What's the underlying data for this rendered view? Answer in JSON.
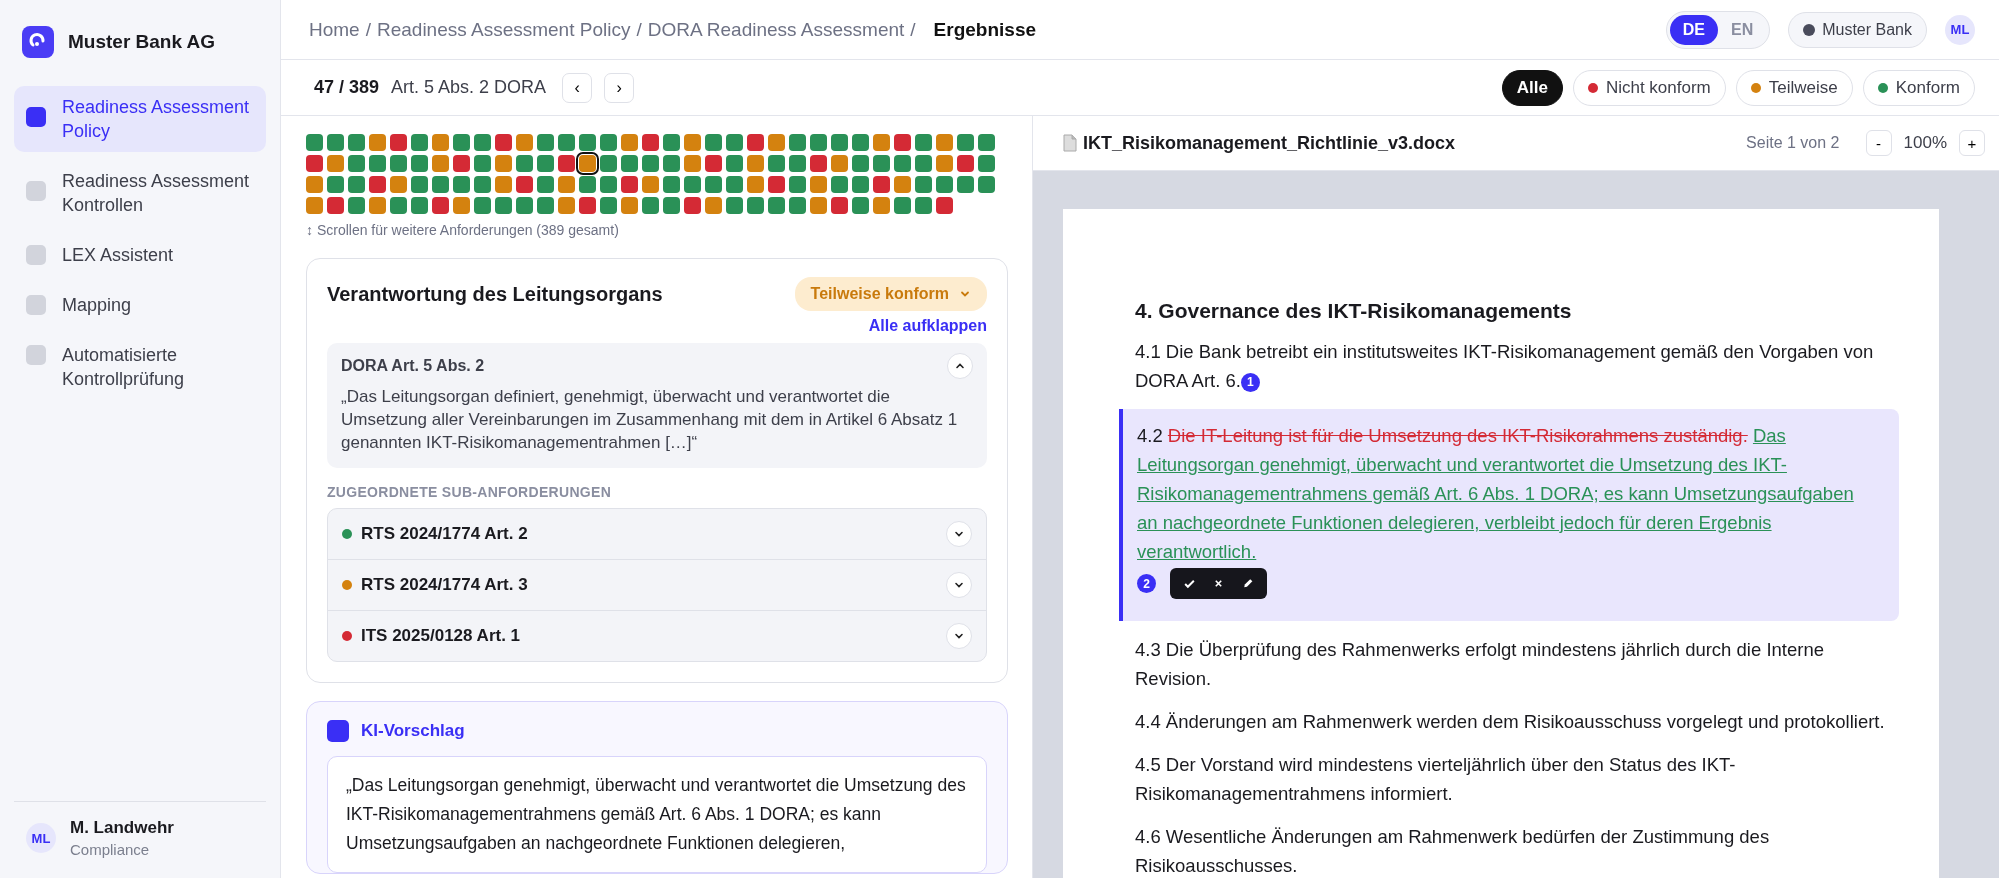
{
  "sidebar": {
    "brand": "Muster Bank AG",
    "items": [
      {
        "label": "Readiness Assessment Policy",
        "selected": true
      },
      {
        "label": "Readiness Assessment Kontrollen",
        "selected": false
      },
      {
        "label": "LEX Assistent",
        "selected": false
      },
      {
        "label": "Mapping",
        "selected": false
      },
      {
        "label": "Automatisierte Kontrollprüfung",
        "selected": false
      }
    ],
    "user": {
      "initials": "ML",
      "name": "M. Landwehr",
      "role": "Compliance"
    }
  },
  "header": {
    "breadcrumb": [
      "Home",
      "Readiness Assessment Policy",
      "DORA Readiness Assessment"
    ],
    "separator": "/",
    "current": "Ergebnisse",
    "languages": [
      {
        "label": "DE",
        "selected": true
      },
      {
        "label": "EN",
        "selected": false
      }
    ],
    "tenant": "Muster Bank",
    "avatar": "ML"
  },
  "toolbar": {
    "position": "47 / 389",
    "requirement": "Art. 5 Abs. 2 DORA",
    "prev": "‹",
    "next": "›",
    "filters": [
      {
        "label": "Alle",
        "selected": true
      },
      {
        "label": "Nicht konform",
        "selected": false,
        "color": "#d42a35"
      },
      {
        "label": "Teilweise",
        "selected": false,
        "color": "#d4820f"
      },
      {
        "label": "Konform",
        "selected": false,
        "color": "#2a9157"
      }
    ]
  },
  "grid": {
    "rows": [
      {
        "cells": [
          {
            "color": "#2a9157",
            "selected": false
          },
          {
            "color": "#2a9157",
            "selected": false
          },
          {
            "color": "#2a9157",
            "selected": false
          },
          {
            "color": "#d4820f",
            "selected": false
          },
          {
            "color": "#d42a35",
            "selected": false
          },
          {
            "color": "#2a9157",
            "selected": false
          },
          {
            "color": "#d4820f",
            "selected": false
          },
          {
            "color": "#2a9157",
            "selected": false
          },
          {
            "color": "#2a9157",
            "selected": false
          },
          {
            "color": "#d42a35",
            "selected": false
          },
          {
            "color": "#d4820f",
            "selected": false
          },
          {
            "color": "#2a9157",
            "selected": false
          },
          {
            "color": "#2a9157",
            "selected": false
          },
          {
            "color": "#2a9157",
            "selected": false
          },
          {
            "color": "#2a9157",
            "selected": false
          },
          {
            "color": "#d4820f",
            "selected": false
          },
          {
            "color": "#d42a35",
            "selected": false
          },
          {
            "color": "#2a9157",
            "selected": false
          },
          {
            "color": "#d4820f",
            "selected": false
          },
          {
            "color": "#2a9157",
            "selected": false
          },
          {
            "color": "#2a9157",
            "selected": false
          },
          {
            "color": "#d42a35",
            "selected": false
          },
          {
            "color": "#d4820f",
            "selected": false
          },
          {
            "color": "#2a9157",
            "selected": false
          },
          {
            "color": "#2a9157",
            "selected": false
          },
          {
            "color": "#2a9157",
            "selected": false
          },
          {
            "color": "#2a9157",
            "selected": false
          },
          {
            "color": "#d4820f",
            "selected": false
          },
          {
            "color": "#d42a35",
            "selected": false
          },
          {
            "color": "#2a9157",
            "selected": false
          },
          {
            "color": "#d4820f",
            "selected": false
          },
          {
            "color": "#2a9157",
            "selected": false
          },
          {
            "color": "#2a9157",
            "selected": false
          }
        ]
      },
      {
        "cells": [
          {
            "color": "#d42a35",
            "selected": false
          },
          {
            "color": "#d4820f",
            "selected": false
          },
          {
            "color": "#2a9157",
            "selected": false
          },
          {
            "color": "#2a9157",
            "selected": false
          },
          {
            "color": "#2a9157",
            "selected": false
          },
          {
            "color": "#2a9157",
            "selected": false
          },
          {
            "color": "#d4820f",
            "selected": false
          },
          {
            "color": "#d42a35",
            "selected": false
          },
          {
            "color": "#2a9157",
            "selected": false
          },
          {
            "color": "#d4820f",
            "selected": false
          },
          {
            "color": "#2a9157",
            "selected": false
          },
          {
            "color": "#2a9157",
            "selected": false
          },
          {
            "color": "#d42a35",
            "selected": false
          },
          {
            "color": "#d4820f",
            "selected": true
          },
          {
            "color": "#2a9157",
            "selected": false
          },
          {
            "color": "#2a9157",
            "selected": false
          },
          {
            "color": "#2a9157",
            "selected": false
          },
          {
            "color": "#2a9157",
            "selected": false
          },
          {
            "color": "#d4820f",
            "selected": false
          },
          {
            "color": "#d42a35",
            "selected": false
          },
          {
            "color": "#2a9157",
            "selected": false
          },
          {
            "color": "#d4820f",
            "selected": false
          },
          {
            "color": "#2a9157",
            "selected": false
          },
          {
            "color": "#2a9157",
            "selected": false
          },
          {
            "color": "#d42a35",
            "selected": false
          },
          {
            "color": "#d4820f",
            "selected": false
          },
          {
            "color": "#2a9157",
            "selected": false
          },
          {
            "color": "#2a9157",
            "selected": false
          },
          {
            "color": "#2a9157",
            "selected": false
          },
          {
            "color": "#2a9157",
            "selected": false
          },
          {
            "color": "#d4820f",
            "selected": false
          },
          {
            "color": "#d42a35",
            "selected": false
          },
          {
            "color": "#2a9157",
            "selected": false
          }
        ]
      },
      {
        "cells": [
          {
            "color": "#d4820f",
            "selected": false
          },
          {
            "color": "#2a9157",
            "selected": false
          },
          {
            "color": "#2a9157",
            "selected": false
          },
          {
            "color": "#d42a35",
            "selected": false
          },
          {
            "color": "#d4820f",
            "selected": false
          },
          {
            "color": "#2a9157",
            "selected": false
          },
          {
            "color": "#2a9157",
            "selected": false
          },
          {
            "color": "#2a9157",
            "selected": false
          },
          {
            "color": "#2a9157",
            "selected": false
          },
          {
            "color": "#d4820f",
            "selected": false
          },
          {
            "color": "#d42a35",
            "selected": false
          },
          {
            "color": "#2a9157",
            "selected": false
          },
          {
            "color": "#d4820f",
            "selected": false
          },
          {
            "color": "#2a9157",
            "selected": false
          },
          {
            "color": "#2a9157",
            "selected": false
          },
          {
            "color": "#d42a35",
            "selected": false
          },
          {
            "color": "#d4820f",
            "selected": false
          },
          {
            "color": "#2a9157",
            "selected": false
          },
          {
            "color": "#2a9157",
            "selected": false
          },
          {
            "color": "#2a9157",
            "selected": false
          },
          {
            "color": "#2a9157",
            "selected": false
          },
          {
            "color": "#d4820f",
            "selected": false
          },
          {
            "color": "#d42a35",
            "selected": false
          },
          {
            "color": "#2a9157",
            "selected": false
          },
          {
            "color": "#d4820f",
            "selected": false
          },
          {
            "color": "#2a9157",
            "selected": false
          },
          {
            "color": "#2a9157",
            "selected": false
          },
          {
            "color": "#d42a35",
            "selected": false
          },
          {
            "color": "#d4820f",
            "selected": false
          },
          {
            "color": "#2a9157",
            "selected": false
          },
          {
            "color": "#2a9157",
            "selected": false
          },
          {
            "color": "#2a9157",
            "selected": false
          },
          {
            "color": "#2a9157",
            "selected": false
          }
        ]
      },
      {
        "cells": [
          {
            "color": "#d4820f",
            "selected": false
          },
          {
            "color": "#d42a35",
            "selected": false
          },
          {
            "color": "#2a9157",
            "selected": false
          },
          {
            "color": "#d4820f",
            "selected": false
          },
          {
            "color": "#2a9157",
            "selected": false
          },
          {
            "color": "#2a9157",
            "selected": false
          },
          {
            "color": "#d42a35",
            "selected": false
          },
          {
            "color": "#d4820f",
            "selected": false
          },
          {
            "color": "#2a9157",
            "selected": false
          },
          {
            "color": "#2a9157",
            "selected": false
          },
          {
            "color": "#2a9157",
            "selected": false
          },
          {
            "color": "#2a9157",
            "selected": false
          },
          {
            "color": "#d4820f",
            "selected": false
          },
          {
            "color": "#d42a35",
            "selected": false
          },
          {
            "color": "#2a9157",
            "selected": false
          },
          {
            "color": "#d4820f",
            "selected": false
          },
          {
            "color": "#2a9157",
            "selected": false
          },
          {
            "color": "#2a9157",
            "selected": false
          },
          {
            "color": "#d42a35",
            "selected": false
          },
          {
            "color": "#d4820f",
            "selected": false
          },
          {
            "color": "#2a9157",
            "selected": false
          },
          {
            "color": "#2a9157",
            "selected": false
          },
          {
            "color": "#2a9157",
            "selected": false
          },
          {
            "color": "#2a9157",
            "selected": false
          },
          {
            "color": "#d4820f",
            "selected": false
          },
          {
            "color": "#d42a35",
            "selected": false
          },
          {
            "color": "#2a9157",
            "selected": false
          },
          {
            "color": "#d4820f",
            "selected": false
          },
          {
            "color": "#2a9157",
            "selected": false
          },
          {
            "color": "#2a9157",
            "selected": false
          },
          {
            "color": "#d42a35",
            "selected": false
          }
        ]
      }
    ],
    "note": "↕ Scrollen für weitere Anforderungen (389 gesamt)"
  },
  "requirement_card": {
    "title": "Verantwortung des Leitungsorgans",
    "status": "Teilweise konform",
    "expand_all": "Alle aufklappen",
    "article": {
      "title": "DORA Art. 5 Abs. 2",
      "expanded": true,
      "quote": "„Das Leitungsorgan definiert, genehmigt, überwacht und verantwortet die Umsetzung aller Vereinbarungen im Zusammenhang mit dem in Artikel 6 Absatz 1 genannten IKT-Risikomanagementrahmen […]“"
    },
    "sub_heading": "ZUGEORDNETE SUB-ANFORDERUNGEN",
    "sub_requirements": [
      {
        "label": "RTS 2024/1774 Art. 2",
        "color": "#2a9157",
        "expanded": false
      },
      {
        "label": "RTS 2024/1774 Art. 3",
        "color": "#d4820f",
        "expanded": false
      },
      {
        "label": "ITS 2025/0128 Art. 1",
        "color": "#d42a35",
        "expanded": false
      }
    ]
  },
  "ai_suggestion": {
    "title": "KI-Vorschlag",
    "text": "„Das Leitungsorgan genehmigt, überwacht und verantwortet die Umsetzung des IKT-Risikomanagementrahmens gemäß Art. 6 Abs. 1 DORA; es kann Umsetzungsaufgaben an nachgeordnete Funktionen delegieren,"
  },
  "document": {
    "filename": "IKT_Risikomanagement_Richtlinie_v3.docx",
    "page_info": "Seite 1 von 2",
    "zoom_out": "-",
    "zoom": "100%",
    "zoom_in": "+",
    "heading": "4. Governance des IKT-Risikomanagements",
    "paragraphs": [
      {
        "kind": "plain",
        "text": "4.1 Die Bank betreibt ein institutsweites IKT-Risikomanagement gemäß den Vorgaben von DORA Art. 6.",
        "marker": "1"
      },
      {
        "kind": "change",
        "number": "4.2",
        "deleted": "Die IT-Leitung ist für die Umsetzung des IKT-Risikorahmens zuständig.",
        "inserted": "Das Leitungsorgan genehmigt, überwacht und verantwortet die Umsetzung des IKT-Risikomanagementrahmens gemäß Art. 6 Abs. 1 DORA; es kann Umsetzungsaufgaben an nachgeordnete Funktionen delegieren, verbleibt jedoch für deren Ergebnis verantwortlich.",
        "marker": "2"
      },
      {
        "kind": "plain",
        "text": "4.3 Die Überprüfung des Rahmenwerks erfolgt mindestens jährlich durch die Interne Revision."
      },
      {
        "kind": "plain",
        "text": "4.4 Änderungen am Rahmenwerk werden dem Risikoausschuss vorgelegt und protokolliert."
      },
      {
        "kind": "plain",
        "text": "4.5 Der Vorstand wird mindestens vierteljährlich über den Status des IKT-Risikomanagementrahmens informiert."
      },
      {
        "kind": "plain",
        "text": "4.6 Wesentliche Änderungen am Rahmenwerk bedürfen der Zustimmung des Risikoausschusses."
      }
    ]
  }
}
